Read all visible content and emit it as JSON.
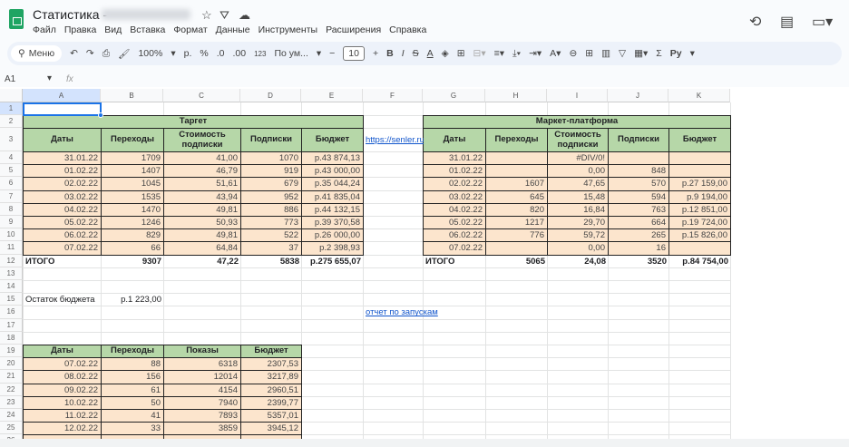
{
  "app": {
    "title": "Статистика -",
    "menu": [
      "Файл",
      "Правка",
      "Вид",
      "Вставка",
      "Формат",
      "Данные",
      "Инструменты",
      "Расширения",
      "Справка"
    ]
  },
  "toolbar": {
    "search": "Меню",
    "zoom": "100%",
    "currency": "р.",
    "percent": "%",
    "dec_less": ".0",
    "dec_more": ".00",
    "format123": "123",
    "font": "По ум...",
    "font_size": "10",
    "input_tools": "Ру"
  },
  "formula_bar": {
    "cell_ref": "A1",
    "fx": "fx"
  },
  "columns": [
    "A",
    "B",
    "C",
    "D",
    "E",
    "F",
    "G",
    "H",
    "I",
    "J",
    "K"
  ],
  "target": {
    "title": "Таргет",
    "headers": [
      "Даты",
      "Переходы",
      "Стоимость подписки",
      "Подписки",
      "Бюджет"
    ],
    "rows": [
      [
        "31.01.22",
        "1709",
        "41,00",
        "1070",
        "р.43 874,13"
      ],
      [
        "01.02.22",
        "1407",
        "46,79",
        "919",
        "р.43 000,00"
      ],
      [
        "02.02.22",
        "1045",
        "51,61",
        "679",
        "р.35 044,24"
      ],
      [
        "03.02.22",
        "1535",
        "43,94",
        "952",
        "р.41 835,04"
      ],
      [
        "04.02.22",
        "1470",
        "49,81",
        "886",
        "р.44 132,15"
      ],
      [
        "05.02.22",
        "1246",
        "50,93",
        "773",
        "р.39 370,58"
      ],
      [
        "06.02.22",
        "829",
        "49,81",
        "522",
        "р.26 000,00"
      ],
      [
        "07.02.22",
        "66",
        "64,84",
        "37",
        "р.2 398,93"
      ]
    ],
    "total": [
      "ИТОГО",
      "9307",
      "47,22",
      "5838",
      "р.275 655,07"
    ]
  },
  "market": {
    "title": "Маркет-платформа",
    "headers": [
      "Даты",
      "Переходы",
      "Стоимость подписки",
      "Подписки",
      "Бюджет"
    ],
    "rows": [
      [
        "31.01.22",
        "",
        "#DIV/0!",
        "",
        ""
      ],
      [
        "01.02.22",
        "",
        "0,00",
        "848",
        ""
      ],
      [
        "02.02.22",
        "1607",
        "47,65",
        "570",
        "р.27 159,00"
      ],
      [
        "03.02.22",
        "645",
        "15,48",
        "594",
        "р.9 194,00"
      ],
      [
        "04.02.22",
        "820",
        "16,84",
        "763",
        "р.12 851,00"
      ],
      [
        "05.02.22",
        "1217",
        "29,70",
        "664",
        "р.19 724,00"
      ],
      [
        "06.02.22",
        "776",
        "59,72",
        "265",
        "р.15 826,00"
      ],
      [
        "07.02.22",
        "",
        "0,00",
        "16",
        ""
      ]
    ],
    "total": [
      "ИТОГО",
      "5065",
      "24,08",
      "3520",
      "р.84 754,00"
    ]
  },
  "link1": "https://senler.ru/",
  "link2": "отчет по запускам",
  "budget_left": {
    "label": "Остаток бюджета",
    "value": "р.1 223,00"
  },
  "ads": {
    "headers": [
      "Даты",
      "Переходы",
      "Показы",
      "Бюджет"
    ],
    "rows": [
      [
        "07.02.22",
        "88",
        "6318",
        "2307,53"
      ],
      [
        "08.02.22",
        "156",
        "12014",
        "3217,89"
      ],
      [
        "09.02.22",
        "61",
        "4154",
        "2960,51"
      ],
      [
        "10.02.22",
        "50",
        "7940",
        "2399,77"
      ],
      [
        "11.02.22",
        "41",
        "7893",
        "5357,01"
      ],
      [
        "12.02.22",
        "33",
        "3859",
        "3945,12"
      ]
    ]
  },
  "colors": {
    "header_green": "#b6d7a8",
    "data_peach": "#fce5cd",
    "link": "#1155cc"
  }
}
